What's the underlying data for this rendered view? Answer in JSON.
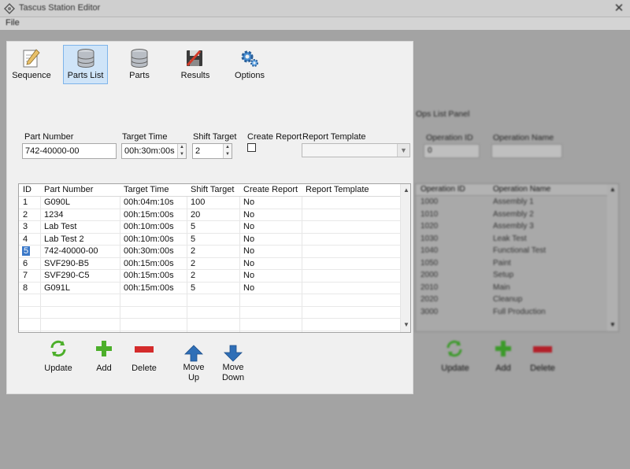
{
  "window": {
    "title": "Tascus Station Editor",
    "close_glyph": "✕"
  },
  "menu": {
    "file": "File"
  },
  "toolbar": {
    "items": [
      {
        "label": "Sequence",
        "icon": "sequence-icon"
      },
      {
        "label": "Parts List",
        "icon": "database-icon",
        "selected": true
      },
      {
        "label": "Parts",
        "icon": "database-icon"
      },
      {
        "label": "Results",
        "icon": "results-icon"
      },
      {
        "label": "Options",
        "icon": "gear-icon"
      }
    ]
  },
  "form": {
    "part_number_label": "Part Number",
    "part_number_value": "742-40000-00",
    "target_time_label": "Target Time",
    "target_time_value": "00h:30m:00s",
    "shift_target_label": "Shift Target",
    "shift_target_value": "2",
    "create_report_label": "Create Report",
    "create_report_checked": false,
    "report_template_label": "Report Template",
    "report_template_value": ""
  },
  "grid": {
    "columns": [
      "ID",
      "Part Number",
      "Target Time",
      "Shift Target",
      "Create Report",
      "Report Template"
    ],
    "rows": [
      [
        "1",
        "G090L",
        "00h:04m:10s",
        "100",
        "No",
        ""
      ],
      [
        "2",
        "1234",
        "00h:15m:00s",
        "20",
        "No",
        ""
      ],
      [
        "3",
        "Lab Test",
        "00h:10m:00s",
        "5",
        "No",
        ""
      ],
      [
        "4",
        "Lab Test 2",
        "00h:10m:00s",
        "5",
        "No",
        ""
      ],
      [
        "5",
        "742-40000-00",
        "00h:30m:00s",
        "2",
        "No",
        ""
      ],
      [
        "6",
        "SVF290-B5",
        "00h:15m:00s",
        "2",
        "No",
        ""
      ],
      [
        "7",
        "SVF290-C5",
        "00h:15m:00s",
        "2",
        "No",
        ""
      ],
      [
        "8",
        "G091L",
        "00h:15m:00s",
        "5",
        "No",
        ""
      ]
    ],
    "selected_row": 4
  },
  "actions": {
    "update": "Update",
    "add": "Add",
    "delete": "Delete",
    "move_up_1": "Move",
    "move_up_2": "Up",
    "move_down_1": "Move",
    "move_down_2": "Down"
  },
  "background_panel": {
    "title": "Ops List Panel",
    "operation_id_label": "Operation ID",
    "operation_id_value": "0",
    "operation_name_label": "Operation Name",
    "operation_name_value": "",
    "columns": [
      "Operation ID",
      "Operation Name"
    ],
    "rows": [
      [
        "1000",
        "Assembly 1"
      ],
      [
        "1010",
        "Assembly 2"
      ],
      [
        "1020",
        "Assembly 3"
      ],
      [
        "1030",
        "Leak Test"
      ],
      [
        "1040",
        "Functional Test"
      ],
      [
        "1050",
        "Paint"
      ],
      [
        "2000",
        "Setup"
      ],
      [
        "2010",
        "Main"
      ],
      [
        "2020",
        "Cleanup"
      ],
      [
        "3000",
        "Full Production"
      ]
    ],
    "update": "Update",
    "add": "Add",
    "delete": "Delete"
  },
  "colors": {
    "accent_selected": "#cfe4f8",
    "selected_id": "#3a78c8",
    "add_green": "#4caf2a",
    "delete_red": "#d42b2b",
    "arrow_blue": "#2f6fb7"
  }
}
